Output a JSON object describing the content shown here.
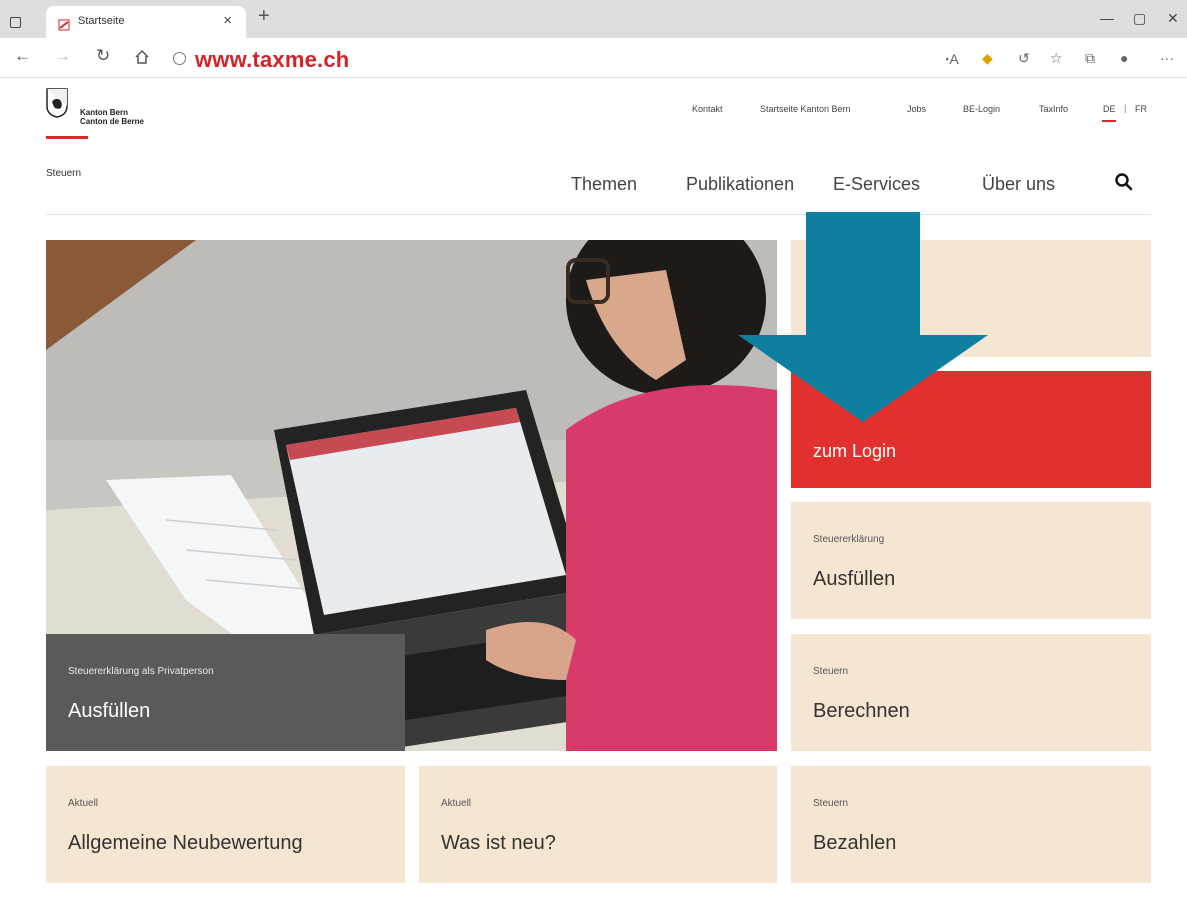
{
  "browser": {
    "tab_title": "Startseite",
    "url": "www.taxme.ch"
  },
  "header": {
    "brand_line1": "Kanton Bern",
    "brand_line2": "Canton de Berne",
    "service_links": [
      "Kontakt",
      "Startseite Kanton Bern",
      "Jobs",
      "BE-Login",
      "TaxInfo"
    ],
    "lang_de": "DE",
    "lang_sep": "|",
    "lang_fr": "FR",
    "section_title": "Steuern",
    "main_nav": [
      "Themen",
      "Publikationen",
      "E-Services",
      "Über uns"
    ]
  },
  "hero": {
    "small": "Steuererklärung als Privatperson",
    "big": "Ausfüllen"
  },
  "login_tile": {
    "label": "zum Login",
    "color": "#e1302e"
  },
  "tiles": {
    "fill": {
      "small": "Steuererklärung",
      "big": "Ausfüllen"
    },
    "calc": {
      "small": "Steuern",
      "big": "Berechnen"
    },
    "reassess": {
      "small": "Aktuell",
      "big": "Allgemeine Neubewertung"
    },
    "news": {
      "small": "Aktuell",
      "big": "Was ist neu?"
    },
    "pay": {
      "small": "Steuern",
      "big": "Bezahlen"
    }
  },
  "colors": {
    "brand_red": "#d52b2b",
    "tile_beige": "#f5e6d2",
    "arrow_blue": "#0f7fa0",
    "url_red": "#d2232a"
  }
}
